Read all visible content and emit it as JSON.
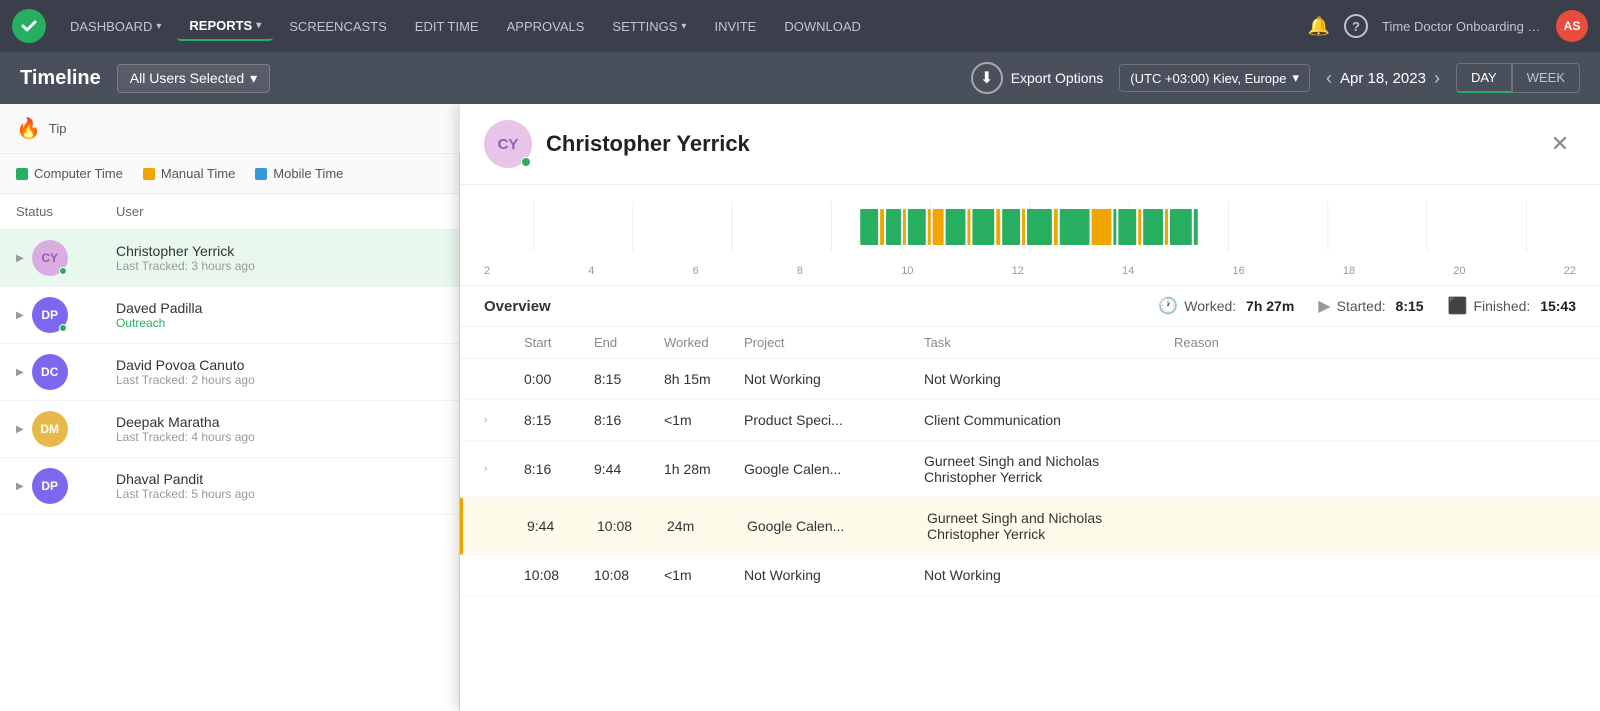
{
  "nav": {
    "logo_check": "✓",
    "items": [
      {
        "label": "DASHBOARD",
        "has_chevron": true,
        "active": false
      },
      {
        "label": "REPORTS",
        "has_chevron": true,
        "active": true
      },
      {
        "label": "SCREENCASTS",
        "has_chevron": false,
        "active": false
      },
      {
        "label": "EDIT TIME",
        "has_chevron": false,
        "active": false
      },
      {
        "label": "APPROVALS",
        "has_chevron": false,
        "active": false
      },
      {
        "label": "SETTINGS",
        "has_chevron": true,
        "active": false
      },
      {
        "label": "INVITE",
        "has_chevron": false,
        "active": false
      },
      {
        "label": "DOWNLOAD",
        "has_chevron": false,
        "active": false
      }
    ],
    "org_name": "Time Doctor Onboarding Tea...",
    "avatar_initials": "AS"
  },
  "sub_header": {
    "title": "Timeline",
    "user_selector": "All Users Selected",
    "export_label": "Export Options",
    "timezone": "(UTC +03:00) Kiev, Europe",
    "date": "Apr 18, 2023",
    "view_day": "DAY",
    "view_week": "WEEK"
  },
  "legend": [
    {
      "label": "Computer Time",
      "color": "#27ae60"
    },
    {
      "label": "Manual Time",
      "color": "#f0a500"
    },
    {
      "label": "Mobile Time",
      "color": "#3498db"
    }
  ],
  "table_headers": {
    "status": "Status",
    "user": "User"
  },
  "users": [
    {
      "initials": "CY",
      "bg": "#d8aee0",
      "text_color": "#9b59b6",
      "name": "Christopher Yerrick",
      "sub": "Last Tracked: 3 hours ago",
      "sub_green": false,
      "active": true,
      "online": true
    },
    {
      "initials": "DP",
      "bg": "#7b68ee",
      "text_color": "white",
      "name": "Daved Padilla",
      "sub": "Outreach",
      "sub_green": true,
      "active": false,
      "online": true
    },
    {
      "initials": "DC",
      "bg": "#7b68ee",
      "text_color": "white",
      "name": "David Povoa Canuto",
      "sub": "Last Tracked: 2 hours ago",
      "sub_green": false,
      "active": false,
      "online": false
    },
    {
      "initials": "DM",
      "bg": "#e8b84b",
      "text_color": "white",
      "name": "Deepak Maratha",
      "sub": "Last Tracked: 4 hours ago",
      "sub_green": false,
      "active": false,
      "online": false
    },
    {
      "initials": "DP",
      "bg": "#7b68ee",
      "text_color": "white",
      "name": "Dhaval Pandit",
      "sub": "Last Tracked: 5 hours ago",
      "sub_green": false,
      "active": false,
      "online": false
    }
  ],
  "detail": {
    "name": "Christopher Yerrick",
    "avatar_initials": "CY",
    "overview_label": "Overview",
    "worked": "7h 27m",
    "started": "8:15",
    "finished": "15:43",
    "axis_labels": [
      "2",
      "4",
      "6",
      "8",
      "10",
      "12",
      "14",
      "16",
      "18",
      "20",
      "22"
    ],
    "table_cols": [
      "",
      "Start",
      "End",
      "Worked",
      "Project",
      "Task",
      "Reason"
    ],
    "rows": [
      {
        "chevron": "",
        "start": "0:00",
        "end": "8:15",
        "worked": "8h 15m",
        "project": "Not Working",
        "task": "Not Working",
        "reason": "",
        "highlighted": false
      },
      {
        "chevron": ">",
        "start": "8:15",
        "end": "8:16",
        "worked": "<1m",
        "project": "Product Speci...",
        "task": "Client Communication",
        "reason": "",
        "highlighted": false
      },
      {
        "chevron": ">",
        "start": "8:16",
        "end": "9:44",
        "worked": "1h 28m",
        "project": "Google Calen...",
        "task": "Gurneet Singh and Nicholas Christopher Yerrick",
        "reason": "",
        "highlighted": false
      },
      {
        "chevron": "",
        "start": "9:44",
        "end": "10:08",
        "worked": "24m",
        "project": "Google Calen...",
        "task": "Gurneet Singh and Nicholas Christopher Yerrick",
        "reason": "",
        "highlighted": true
      },
      {
        "chevron": "",
        "start": "10:08",
        "end": "10:08",
        "worked": "<1m",
        "project": "Not Working",
        "task": "Not Working",
        "reason": "",
        "highlighted": false
      }
    ]
  }
}
